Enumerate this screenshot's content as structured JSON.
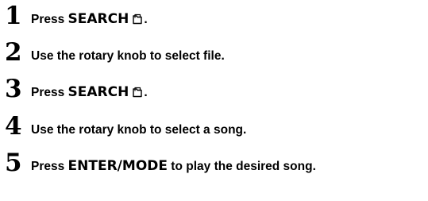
{
  "steps": [
    {
      "number": "1",
      "prefix": "Press ",
      "key": "SEARCH",
      "icon": "search-folder-icon",
      "suffix": "."
    },
    {
      "number": "2",
      "text": "Use the rotary knob to select file."
    },
    {
      "number": "3",
      "prefix": "Press ",
      "key": "SEARCH",
      "icon": "search-folder-icon",
      "suffix": "."
    },
    {
      "number": "4",
      "text": "Use the rotary knob to select a song."
    },
    {
      "number": "5",
      "prefix": "Press ",
      "key": "ENTER/MODE",
      "suffix": " to play the desired song."
    }
  ]
}
